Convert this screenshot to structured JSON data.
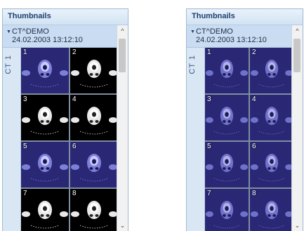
{
  "panels": [
    {
      "id": "left",
      "title": "Thumbnails",
      "patient_name": "CT^DEMO",
      "study_datetime": "24.02.2003 13:12:10",
      "series_label": "CT 1",
      "style": "bright",
      "thumbnails": [
        {
          "number": "1",
          "colormap": "blue"
        },
        {
          "number": "2",
          "colormap": "gray"
        },
        {
          "number": "3",
          "colormap": "gray"
        },
        {
          "number": "4",
          "colormap": "gray"
        },
        {
          "number": "5",
          "colormap": "blue"
        },
        {
          "number": "6",
          "colormap": "blue"
        },
        {
          "number": "7",
          "colormap": "gray"
        },
        {
          "number": "8",
          "colormap": "gray"
        }
      ],
      "scroll_up_icon": "chevron-up-icon",
      "scroll_down_icon": "chevron-down-icon"
    },
    {
      "id": "right",
      "title": "Thumbnails",
      "patient_name": "CT^DEMO",
      "study_datetime": "24.02.2003 13:12:10",
      "series_label": "CT 1",
      "style": "dim",
      "thumbnails": [
        {
          "number": "1",
          "colormap": "blue"
        },
        {
          "number": "2",
          "colormap": "blue"
        },
        {
          "number": "3",
          "colormap": "blue"
        },
        {
          "number": "4",
          "colormap": "blue"
        },
        {
          "number": "5",
          "colormap": "blue"
        },
        {
          "number": "6",
          "colormap": "blue"
        },
        {
          "number": "7",
          "colormap": "blue"
        },
        {
          "number": "8",
          "colormap": "blue"
        }
      ],
      "scroll_up_icon": "chevron-up-icon",
      "scroll_down_icon": "chevron-down-icon"
    }
  ],
  "colors": {
    "title_text": "#1f3f6e",
    "panel_bg": "#dde9f5",
    "header_bg": "#c9dcf1",
    "blue_scan_bg": "#2a2775",
    "blue_scan_tissue": "#7d7fd9",
    "gray_scan_bg": "#000000",
    "gray_scan_tissue": "#e8e8e8"
  }
}
